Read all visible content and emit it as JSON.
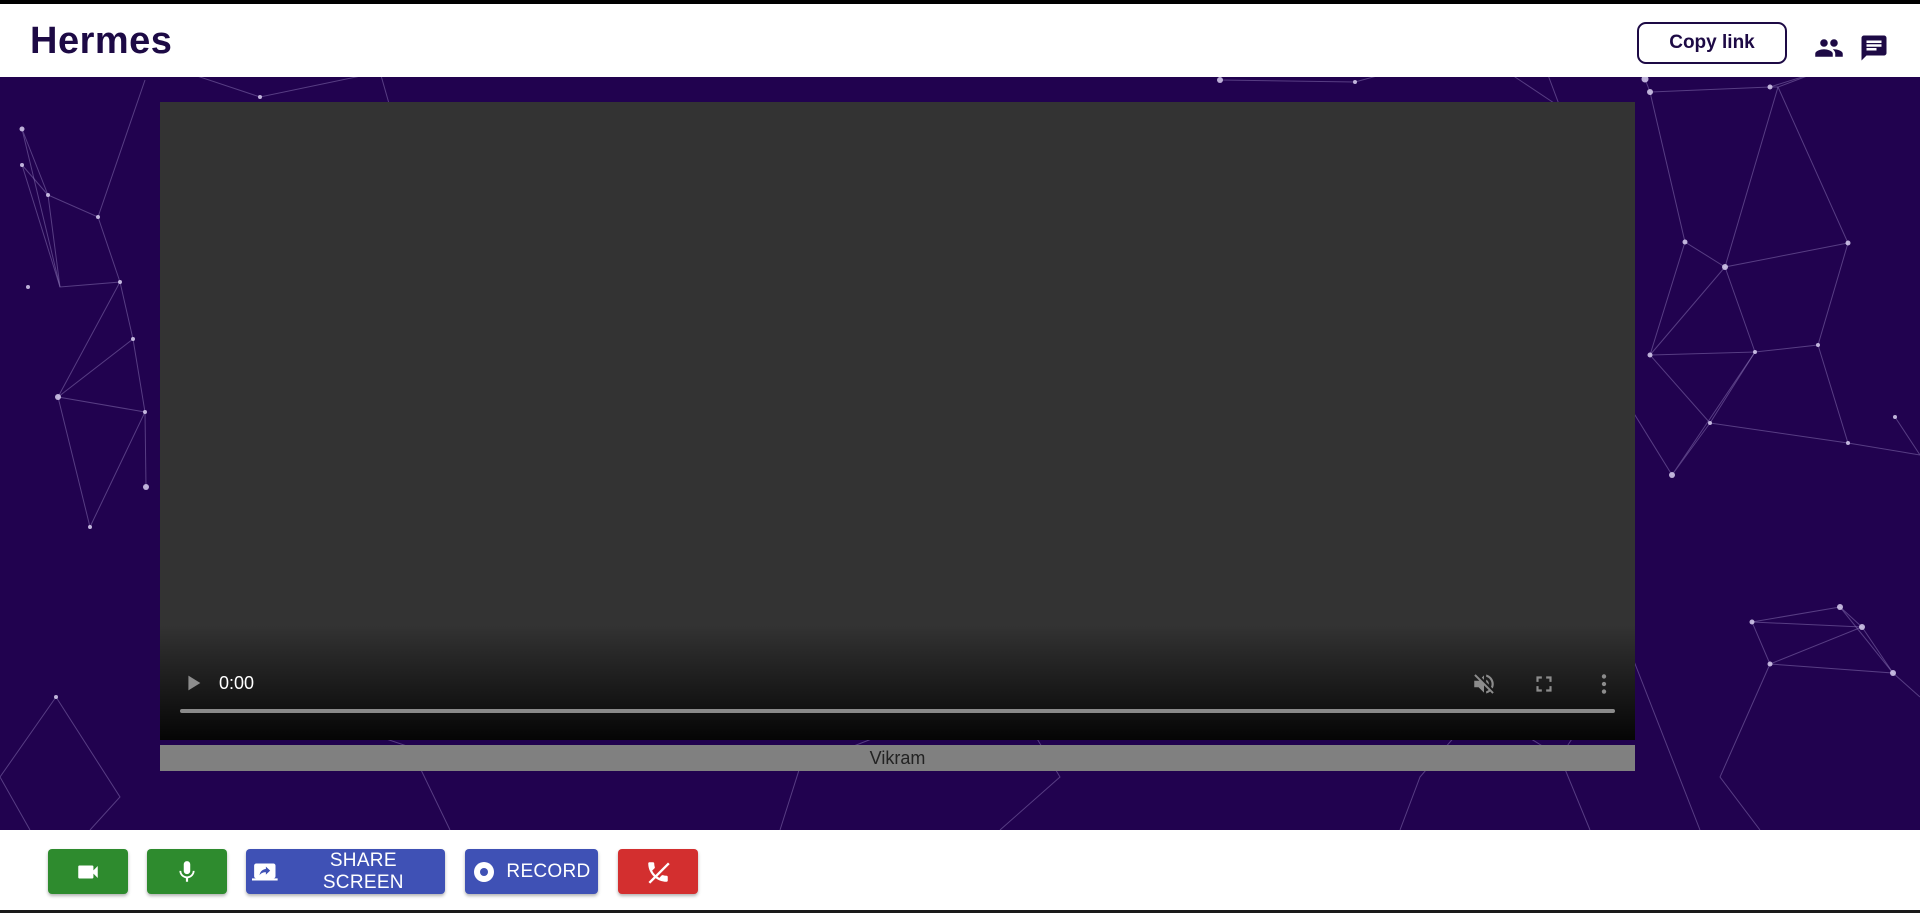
{
  "header": {
    "app_title": "Hermes",
    "copy_link_label": "Copy link",
    "participants_icon": "people-icon",
    "chat_icon": "chat-icon"
  },
  "video": {
    "time": "0:00",
    "participant_name": "Vikram",
    "controls": {
      "play_icon": "play-icon",
      "mute_icon": "volume-off-icon",
      "fullscreen_icon": "fullscreen-icon",
      "more_icon": "more-vert-icon"
    }
  },
  "toolbar": {
    "camera_icon": "videocam-icon",
    "mic_icon": "mic-icon",
    "share_screen_label": "SHARE SCREEN",
    "record_label": "RECORD",
    "end_call_icon": "call-end-icon"
  },
  "colors": {
    "brand": "#1d0a45",
    "stage_background": "#21024f",
    "green_button": "#2e8b2e",
    "blue_button": "#3f51b5",
    "red_button": "#d32f2f"
  }
}
